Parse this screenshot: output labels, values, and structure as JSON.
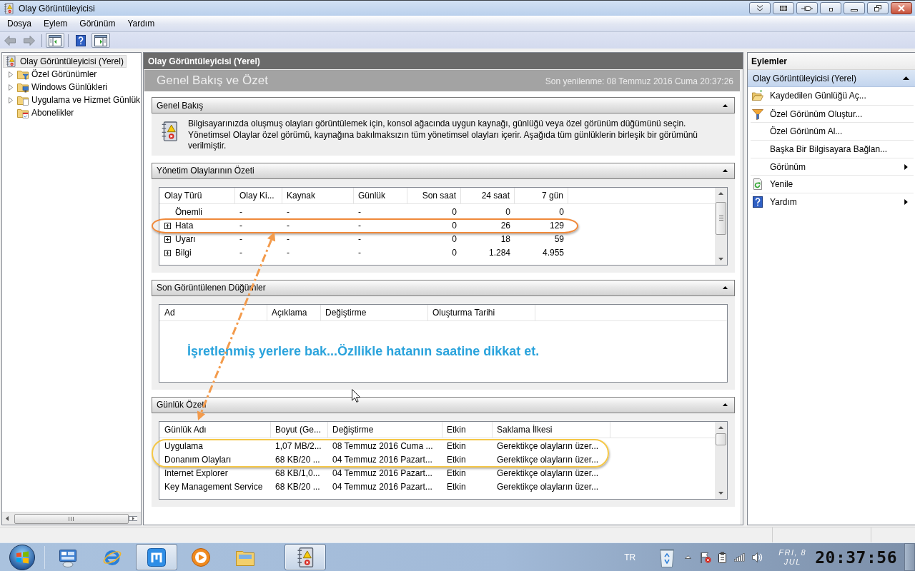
{
  "window": {
    "title": "Olay Görüntüleyicisi"
  },
  "menu": [
    "Dosya",
    "Eylem",
    "Görünüm",
    "Yardım"
  ],
  "toolbar": {
    "groups": [
      {
        "buttons": [
          {
            "disabled": true,
            "pressed": false
          },
          {
            "disabled": true,
            "pressed": false
          }
        ]
      },
      {
        "buttons": [
          {
            "disabled": false,
            "pressed": true
          }
        ]
      },
      {
        "buttons": [
          {
            "disabled": false,
            "pressed": false
          },
          {
            "disabled": false,
            "pressed": true
          }
        ]
      }
    ]
  },
  "tree": {
    "label": "Olay Görüntüleyicisi (Yerel)",
    "selected": true,
    "children": [
      {
        "label": "Özel Görünümler",
        "selected": false,
        "expandable": true
      },
      {
        "label": "Windows Günlükleri",
        "selected": false,
        "expandable": true
      },
      {
        "label": "Uygulama ve Hizmet Günlük",
        "selected": false,
        "expandable": true
      },
      {
        "label": "Abonelikler",
        "selected": false,
        "expandable": false
      }
    ]
  },
  "content": {
    "header": "Olay Görüntüleyicisi (Yerel)",
    "title": "Genel Bakış ve Özet",
    "last_refresh": "Son yenilenme: 08 Temmuz 2016 Cuma 20:37:26",
    "sections": [
      {
        "kind": "text",
        "title": "Genel Bakış",
        "expanded": true,
        "text": "Bilgisayarınızda oluşmuş olayları görüntülemek için, konsol ağacında uygun kaynağı, günlüğü veya özel görünüm düğümünü seçin. Yönetimsel Olaylar özel görümü, kaynağına bakılmaksızın tüm yönetimsel olayları içerir. Aşağıda tüm günlüklerin birleşik bir görümünü verilmiştir."
      },
      {
        "kind": "table",
        "title": "Yönetim Olaylarının Özeti",
        "expanded": true,
        "table": {
          "columns": [
            "Olay Türü",
            "Olay Ki...",
            "Kaynak",
            "Günlük",
            "Son saat",
            "24 saat",
            "7 gün"
          ],
          "rows": [
            {
              "expandable": false,
              "circled": false,
              "cells": [
                "Önemli",
                "-",
                "-",
                "-",
                "0",
                "0",
                "0"
              ]
            },
            {
              "expandable": true,
              "circled": true,
              "cells": [
                "Hata",
                "-",
                "-",
                "-",
                "0",
                "26",
                "129"
              ]
            },
            {
              "expandable": true,
              "circled": false,
              "cells": [
                "Uyarı",
                "-",
                "-",
                "-",
                "0",
                "18",
                "59"
              ]
            },
            {
              "expandable": true,
              "circled": false,
              "cells": [
                "Bilgi",
                "-",
                "-",
                "-",
                "0",
                "1.284",
                "4.955"
              ]
            }
          ]
        }
      },
      {
        "kind": "table",
        "title": "Son Görüntülenen Düğümler",
        "expanded": true,
        "table": {
          "columns": [
            "Ad",
            "Açıklama",
            "Değiştirme",
            "Oluşturma Tarihi"
          ]
        }
      },
      {
        "kind": "table",
        "title": "Günlük Özeti",
        "expanded": true,
        "table": {
          "columns": [
            "Günlük Adı",
            "Boyut (Ge...",
            "Değiştirme",
            "Etkin",
            "Saklama İlkesi"
          ],
          "rows": [
            {
              "circled": true,
              "cells": [
                "Uygulama",
                "1,07 MB/2...",
                "08 Temmuz 2016 Cuma ...",
                "Etkin",
                "Gerektikçe olayların üzer..."
              ]
            },
            {
              "circled": true,
              "cells": [
                "Donanım Olayları",
                "68 KB/20 ...",
                "04 Temmuz 2016 Pazart...",
                "Etkin",
                "Gerektikçe olayların üzer..."
              ]
            },
            {
              "circled": false,
              "cells": [
                "Internet Explorer",
                "68 KB/1,0...",
                "04 Temmuz 2016 Pazart...",
                "Etkin",
                "Gerektikçe olayların üzer..."
              ]
            },
            {
              "circled": false,
              "cells": [
                "Key Management Service",
                "68 KB/20 ...",
                "04 Temmuz 2016 Pazart...",
                "Etkin",
                "Gerektikçe olayların üzer..."
              ]
            }
          ]
        }
      }
    ]
  },
  "annotation": {
    "text": "İşretlenmiş yerlere bak...Özllikle hatanın saatine dikkat et."
  },
  "actions": {
    "title": "Eylemler",
    "group": {
      "label": "Olay Görüntüleyicisi (Yerel)",
      "expanded": true,
      "items": [
        {
          "label": "Kaydedilen Günlüğü Aç...",
          "submenu": false
        },
        {
          "label": "Özel Görünüm Oluştur...",
          "submenu": false
        },
        {
          "label": "Özel Görünüm Al...",
          "submenu": false
        },
        {
          "label": "Başka Bir Bilgisayara Bağlan...",
          "submenu": false
        },
        {
          "label": "Görünüm",
          "submenu": true
        },
        {
          "label": "Yenile",
          "submenu": false
        },
        {
          "label": "Yardım",
          "submenu": true
        }
      ]
    }
  },
  "taskbar": {
    "apps": [
      {
        "running": false
      },
      {
        "running": false
      },
      {
        "running": true
      },
      {
        "running": false
      },
      {
        "running": false
      },
      {
        "running": true
      }
    ],
    "language": "TR",
    "date": "FRI, 8",
    "month": "JUL",
    "clock": "20:37:56"
  }
}
